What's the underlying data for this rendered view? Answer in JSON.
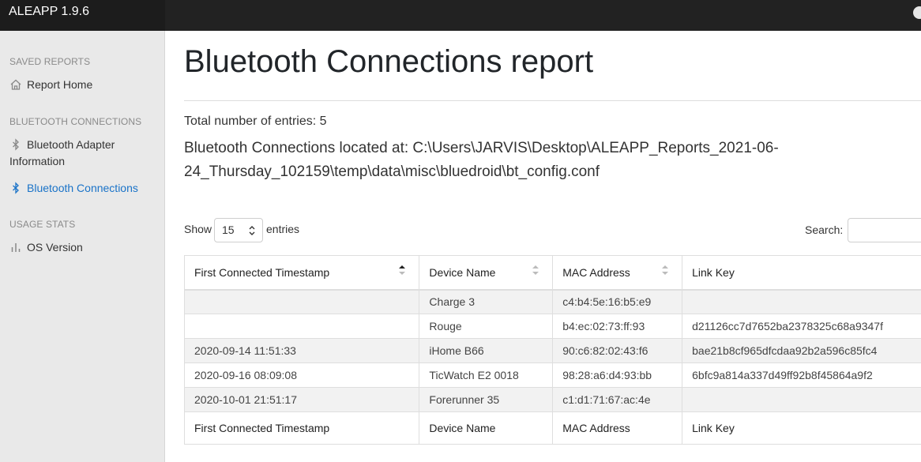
{
  "app": {
    "title": "ALEAPP 1.9.6"
  },
  "sidebar": {
    "sections": [
      {
        "heading": "SAVED REPORTS",
        "items": [
          {
            "label": "Report Home",
            "icon": "home-icon"
          }
        ]
      },
      {
        "heading": "BLUETOOTH CONNECTIONS",
        "items": [
          {
            "label": "Bluetooth Adapter Information",
            "icon": "bluetooth-icon"
          },
          {
            "label": "Bluetooth Connections",
            "icon": "bluetooth-icon",
            "active": true
          }
        ]
      },
      {
        "heading": "USAGE STATS",
        "items": [
          {
            "label": "OS Version",
            "icon": "bar-chart-icon"
          }
        ]
      }
    ]
  },
  "report": {
    "title": "Bluetooth Connections report",
    "total": "Total number of entries: 5",
    "location": "Bluetooth Connections located at: C:\\Users\\JARVIS\\Desktop\\ALEAPP_Reports_2021-06-24_Thursday_102159\\temp\\data\\misc\\bluedroid\\bt_config.conf"
  },
  "controls": {
    "show_label": "Show",
    "page_size": "15",
    "entries_label": "entries",
    "search_label": "Search:",
    "search_value": ""
  },
  "table": {
    "columns": [
      "First Connected Timestamp",
      "Device Name",
      "MAC Address",
      "Link Key"
    ],
    "rows": [
      [
        "",
        "Charge 3",
        "c4:b4:5e:16:b5:e9",
        ""
      ],
      [
        "",
        "Rouge",
        "b4:ec:02:73:ff:93",
        "d21126cc7d7652ba2378325c68a9347f"
      ],
      [
        "2020-09-14 11:51:33",
        "iHome B66",
        "90:c6:82:02:43:f6",
        "bae21b8cf965dfcdaa92b2a596c85fc4"
      ],
      [
        "2020-09-16 08:09:08",
        "TicWatch E2 0018",
        "98:28:a6:d4:93:bb",
        "6bfc9a814a337d49ff92b8f45864a9f2"
      ],
      [
        "2020-10-01 21:51:17",
        "Forerunner 35",
        "c1:d1:71:67:ac:4e",
        ""
      ]
    ]
  },
  "colors": {
    "topbar": "#222222",
    "sidebar": "#e9e9e9",
    "active_link": "#1a73c8"
  }
}
